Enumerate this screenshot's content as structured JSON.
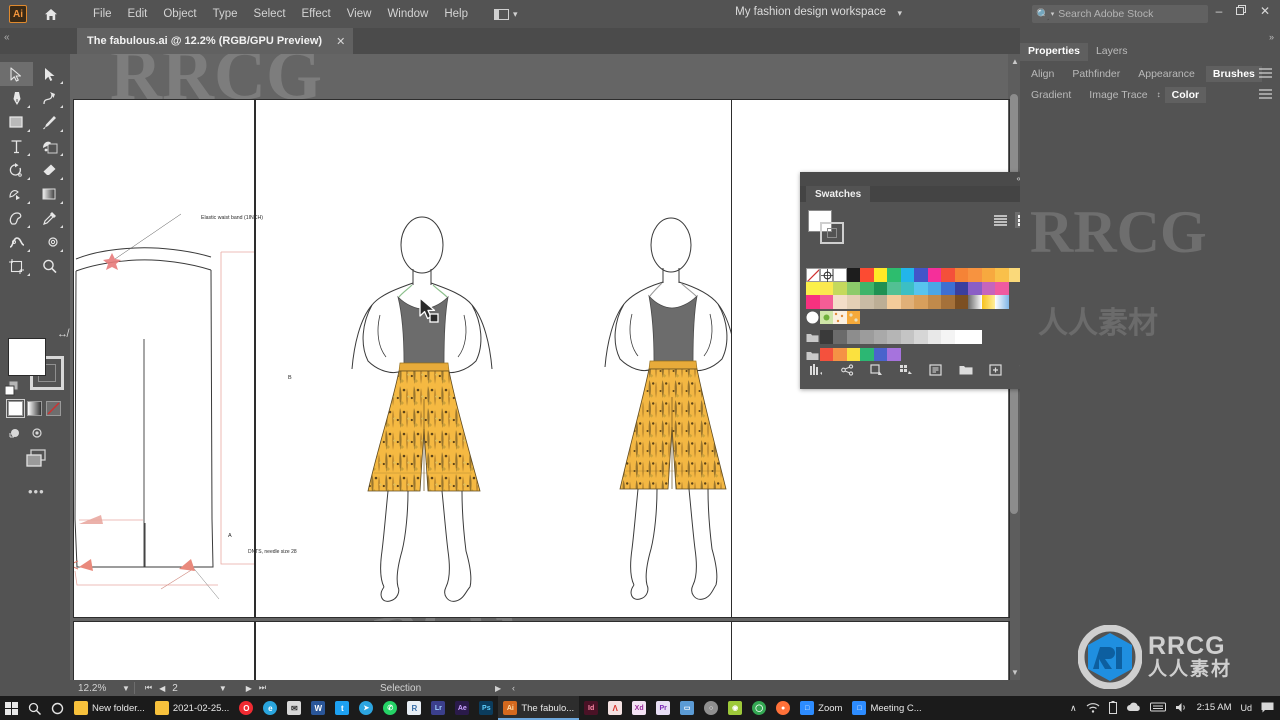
{
  "app": {
    "logo_text": "Ai",
    "home_icon": "home-icon"
  },
  "menubar": {
    "items": [
      "File",
      "Edit",
      "Object",
      "Type",
      "Select",
      "Effect",
      "View",
      "Window",
      "Help"
    ],
    "arrange_icon": "arrange-documents-icon",
    "workspace": "My fashion design workspace",
    "workspace_chevron": "chevron-down-icon",
    "search_icon": "search-icon",
    "search_placeholder": "Search Adobe Stock",
    "window_minimize": "–",
    "window_restore": "❐",
    "window_close": "✕"
  },
  "tabs": {
    "collapse": "«",
    "active_tab": "The fabulous.ai @ 12.2% (RGB/GPU Preview)",
    "close_glyph": "✕"
  },
  "toolbar": {
    "tools": [
      {
        "name": "selection-tool",
        "glyph": "arrow"
      },
      {
        "name": "direct-selection-tool",
        "glyph": "arrow-solid"
      },
      {
        "name": "pen-tool",
        "glyph": "pen"
      },
      {
        "name": "curvature-tool",
        "glyph": "curvature"
      },
      {
        "name": "rectangle-tool",
        "glyph": "rect"
      },
      {
        "name": "paintbrush-tool",
        "glyph": "brush"
      },
      {
        "name": "type-tool",
        "glyph": "T"
      },
      {
        "name": "shape-builder-tool",
        "glyph": "shapebuilder"
      },
      {
        "name": "rotate-tool",
        "glyph": "rotate"
      },
      {
        "name": "eraser-tool",
        "glyph": "eraser"
      },
      {
        "name": "free-transform-tool",
        "glyph": "transform"
      },
      {
        "name": "gradient-tool",
        "glyph": "gradient"
      },
      {
        "name": "blob-brush-tool",
        "glyph": "blob"
      },
      {
        "name": "eyedropper-tool",
        "glyph": "eyedropper"
      },
      {
        "name": "width-tool",
        "glyph": "width"
      },
      {
        "name": "blend-tool",
        "glyph": "blend"
      },
      {
        "name": "artboard-tool",
        "glyph": "artboard"
      },
      {
        "name": "zoom-tool",
        "glyph": "magnifier"
      }
    ],
    "fill_color": "#ffffff",
    "stroke_color": "#ffffff",
    "swap_icon": "swap-fill-stroke-icon",
    "default_icon": "default-fill-stroke-icon",
    "paint_modes": [
      "color-fill",
      "gradient-fill",
      "none-fill"
    ],
    "screen_modes": [
      "draw-normal",
      "draw-behind"
    ],
    "arrange_doc_icon": "change-screen-mode-icon",
    "more_tools": "•••"
  },
  "canvas": {
    "annotations": {
      "waistband": "Elastic waist band (1INCH)",
      "dim_b": "B",
      "dim_a": "A",
      "needle": "DNTS, needle size 28"
    }
  },
  "swatches_panel": {
    "title": "Swatches",
    "collapse_icon": "collapse-panel-icon",
    "close_icon": "close-panel-icon",
    "menu_icon": "panel-menu-icon",
    "view_list_icon": "list-view-icon",
    "view_grid_icon": "grid-view-icon",
    "footer_icons": [
      "swatch-libraries-icon",
      "show-swatch-kinds-icon",
      "color-group-icon",
      "edit-colors-icon",
      "swatch-options-icon",
      "new-color-group-icon",
      "new-swatch-icon",
      "delete-swatch-icon"
    ],
    "rows": [
      [
        "none",
        "registration",
        "white-swatch",
        "#1d1d1d",
        "#fc4b32",
        "#ffe927",
        "#2dbd6e",
        "#22b5ea",
        "#4255c9",
        "#f52f9a",
        "#f4503a",
        "#f58336",
        "#f79340",
        "#f7a93f",
        "#f9c04a",
        "#fad97a"
      ],
      [
        "#fbf04a",
        "#fbe84f",
        "#c5d95c",
        "#8ccb6a",
        "#3eb46a",
        "#1f9152",
        "#52c093",
        "#3cbfc4",
        "#58c4ee",
        "#4aa6e6",
        "#3e6fd1",
        "#3a3f9e",
        "#8a5ec6",
        "#c565bd",
        "#ef5ba0"
      ],
      [
        "#f7317f",
        "#f45d96",
        "#f3ddc8",
        "#e4cfb5",
        "#c9bba4",
        "#bcae95",
        "#f3cb9a",
        "#e0b078",
        "#d79f5c",
        "#c08a4b",
        "#a5713a",
        "#7c4f22",
        "#ffffff",
        "#ffd84a",
        "#9ecdf2"
      ],
      [
        "pattern-white",
        "pattern-green",
        "pattern-dots",
        "pattern-orange"
      ],
      [
        "folder-icon",
        "#3a3a3a",
        "#6b6b6b",
        "#8d8d8d",
        "#9c9c9c",
        "#a9a9a9",
        "#b5b5b5",
        "#c4c4c4",
        "#d6d6d6",
        "#e8e8e8",
        "#f4f4f4",
        "#ffffff",
        "#ffffff"
      ],
      [
        "folder-icon",
        "#f4513d",
        "#f59245",
        "#fbe13f",
        "#2cb773",
        "#4a63cc",
        "#a673dd"
      ]
    ]
  },
  "right_panel": {
    "collapse_icon": "expand-panels-icon",
    "main_tabs": [
      {
        "label": "Properties",
        "active": true
      },
      {
        "label": "Layers",
        "active": false
      }
    ],
    "row2": [
      {
        "label": "Align",
        "active": false
      },
      {
        "label": "Pathfinder",
        "active": false
      },
      {
        "label": "Appearance",
        "active": false
      },
      {
        "label": "Brushes",
        "active": true
      }
    ],
    "row3": [
      {
        "label": "Gradient",
        "active": false
      },
      {
        "label": "Image Trace",
        "active": false
      },
      {
        "label": "Color",
        "active": true
      }
    ],
    "menu_icon": "panel-menu-icon"
  },
  "statusbar": {
    "zoom": "12.2%",
    "zoom_chevron": "chevron-down-icon",
    "first_icon": "first-artboard-icon",
    "prev_icon": "previous-artboard-icon",
    "artboard_number": "2",
    "artboard_chevron": "chevron-down-icon",
    "next_icon": "next-artboard-icon",
    "last_icon": "last-artboard-icon",
    "tool_status": "Selection",
    "play_icon": "status-menu-icon",
    "left_icon": "scroll-left-icon"
  },
  "taskbar": {
    "start_icon": "windows-start-icon",
    "search_icon": "search-icon",
    "cortana_icon": "cortana-icon",
    "items": [
      {
        "name": "folder-new",
        "label": "New folder...",
        "color": "#f7c13c",
        "glyph": "",
        "active": false
      },
      {
        "name": "folder-2021",
        "label": "2021-02-25...",
        "color": "#f7c13c",
        "glyph": "",
        "active": false
      },
      {
        "name": "opera",
        "label": "",
        "color": "#f02b32",
        "glyph": "O",
        "active": false
      },
      {
        "name": "edge",
        "label": "",
        "color": "#2aa5dd",
        "glyph": "e",
        "active": false
      },
      {
        "name": "mail",
        "label": "",
        "color": "#d8d8d8",
        "glyph": "✉",
        "active": false
      },
      {
        "name": "word",
        "label": "",
        "color": "#2a5699",
        "glyph": "W",
        "active": false
      },
      {
        "name": "twitter",
        "label": "",
        "color": "#1da1f2",
        "glyph": "t",
        "active": false
      },
      {
        "name": "telegram",
        "label": "",
        "color": "#2ca5e0",
        "glyph": "➤",
        "active": false
      },
      {
        "name": "whatsapp",
        "label": "",
        "color": "#25d366",
        "glyph": "✆",
        "active": false
      },
      {
        "name": "r-app",
        "label": "",
        "color": "#e8eef5",
        "glyph": "R",
        "active": false
      },
      {
        "name": "lightroom",
        "label": "",
        "color": "#3b3f8c",
        "glyph": "Lr",
        "active": false
      },
      {
        "name": "after-effects",
        "label": "",
        "color": "#2a1a4a",
        "glyph": "Ae",
        "active": false
      },
      {
        "name": "photoshop",
        "label": "",
        "color": "#0b3c5d",
        "glyph": "Ps",
        "active": false
      },
      {
        "name": "illustrator",
        "label": "The fabulo...",
        "color": "#d4691e",
        "glyph": "Ai",
        "active": true
      },
      {
        "name": "indesign",
        "label": "",
        "color": "#4a1226",
        "glyph": "Id",
        "active": false
      },
      {
        "name": "acrobat",
        "label": "",
        "color": "#e8473f",
        "glyph": "Λ",
        "active": false
      },
      {
        "name": "xd",
        "label": "",
        "color": "#470137",
        "glyph": "Xd",
        "active": false
      },
      {
        "name": "premiere",
        "label": "",
        "color": "#2a0a3a",
        "glyph": "Pr",
        "active": false
      },
      {
        "name": "file-explorer",
        "label": "",
        "color": "#5b9bd5",
        "glyph": "▭",
        "active": false
      },
      {
        "name": "chrome-alt",
        "label": "",
        "color": "#8f8f8f",
        "glyph": "○",
        "active": false
      },
      {
        "name": "green-app",
        "label": "",
        "color": "#9dc93a",
        "glyph": "◉",
        "active": false
      },
      {
        "name": "chrome",
        "label": "",
        "color": "#34a853",
        "glyph": "◯",
        "active": false
      },
      {
        "name": "firefox",
        "label": "",
        "color": "#ff7139",
        "glyph": "●",
        "active": false
      },
      {
        "name": "zoom",
        "label": "Zoom",
        "color": "#2d8cff",
        "glyph": "□",
        "active": false
      },
      {
        "name": "zoom-meeting",
        "label": "Meeting C...",
        "color": "#2d8cff",
        "glyph": "□",
        "active": false
      }
    ],
    "tray": {
      "chevron": "∧",
      "wifi_icon": "wifi-icon",
      "battery_icon": "battery-icon",
      "cloud_icon": "cloud-icon",
      "keyboard_icon": "keyboard-icon",
      "volume_icon": "volume-icon"
    },
    "clock_time": "2:15 AM",
    "ime_label": "Ud",
    "notification_icon": "notifications-icon"
  },
  "watermarks": {
    "brand": "RRCG",
    "cn": "人人素材"
  }
}
